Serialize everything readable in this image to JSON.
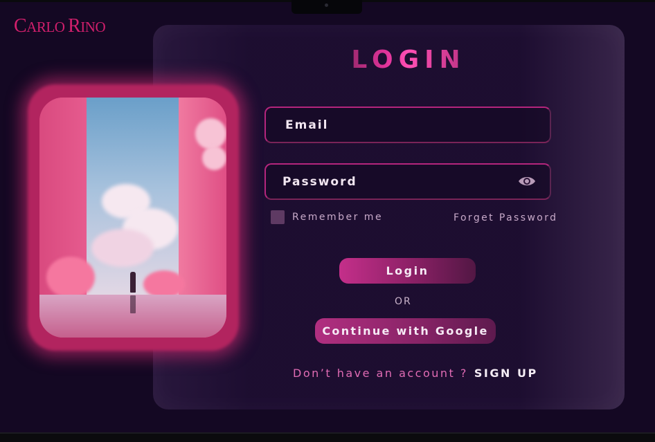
{
  "brand": {
    "logo_text": "CARLO RINO"
  },
  "login": {
    "title": "LOGIN",
    "email_placeholder": "Email",
    "password_placeholder": "Password",
    "remember_label": "Remember me",
    "forget_label": "Forget Password",
    "login_button": "Login",
    "or_text": "OR",
    "google_button": "Continue with Google",
    "no_account_text": "Don’t have an account ?",
    "signup_link": "SIGN UP"
  },
  "icons": {
    "password_toggle": "eye-icon"
  },
  "colors": {
    "background": "#140823",
    "brand": "#d11f6c",
    "accent_pink": "#e0339a",
    "field_border": "#b5257d",
    "signup_prompt": "#e16cb4"
  }
}
